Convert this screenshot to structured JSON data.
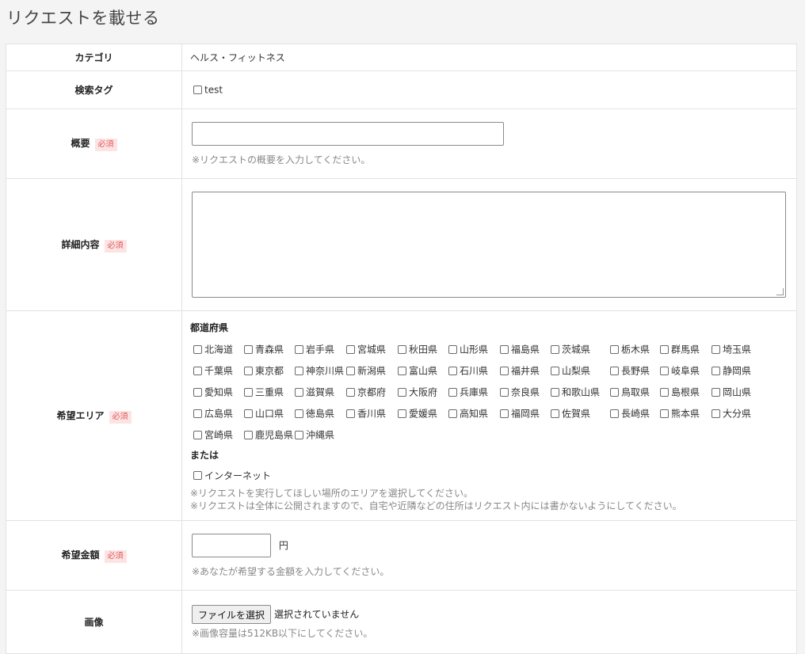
{
  "page": {
    "title": "リクエストを載せる"
  },
  "rows": {
    "category": {
      "label": "カテゴリ",
      "value": "ヘルス・フィットネス"
    },
    "search_tag": {
      "label": "検索タグ",
      "option": "test"
    },
    "summary": {
      "label": "概要",
      "required": "必須",
      "value": "",
      "note": "※リクエストの概要を入力してください。"
    },
    "details": {
      "label": "詳細内容",
      "required": "必須",
      "value": ""
    },
    "area": {
      "label": "希望エリア",
      "required": "必須",
      "prefectures_heading": "都道府県",
      "prefectures": [
        "北海道",
        "青森県",
        "岩手県",
        "宮城県",
        "秋田県",
        "山形県",
        "福島県",
        "茨城県",
        "栃木県",
        "群馬県",
        "埼玉県",
        "千葉県",
        "東京都",
        "神奈川県",
        "新潟県",
        "富山県",
        "石川県",
        "福井県",
        "山梨県",
        "長野県",
        "岐阜県",
        "静岡県",
        "愛知県",
        "三重県",
        "滋賀県",
        "京都府",
        "大阪府",
        "兵庫県",
        "奈良県",
        "和歌山県",
        "鳥取県",
        "島根県",
        "岡山県",
        "広島県",
        "山口県",
        "徳島県",
        "香川県",
        "愛媛県",
        "高知県",
        "福岡県",
        "佐賀県",
        "長崎県",
        "熊本県",
        "大分県",
        "宮崎県",
        "鹿児島県",
        "沖縄県"
      ],
      "or_label": "または",
      "internet_option": "インターネット",
      "note1": "※リクエストを実行してほしい場所のエリアを選択してください。",
      "note2": "※リクエストは全体に公開されますので、自宅や近隣などの住所はリクエスト内には書かないようにしてください。"
    },
    "amount": {
      "label": "希望金額",
      "required": "必須",
      "value": "",
      "unit": "円",
      "note": "※あなたが希望する金額を入力してください。"
    },
    "image": {
      "label": "画像",
      "button": "ファイルを選択",
      "status": "選択されていません",
      "note": "※画像容量は512KB以下にしてください。"
    }
  }
}
